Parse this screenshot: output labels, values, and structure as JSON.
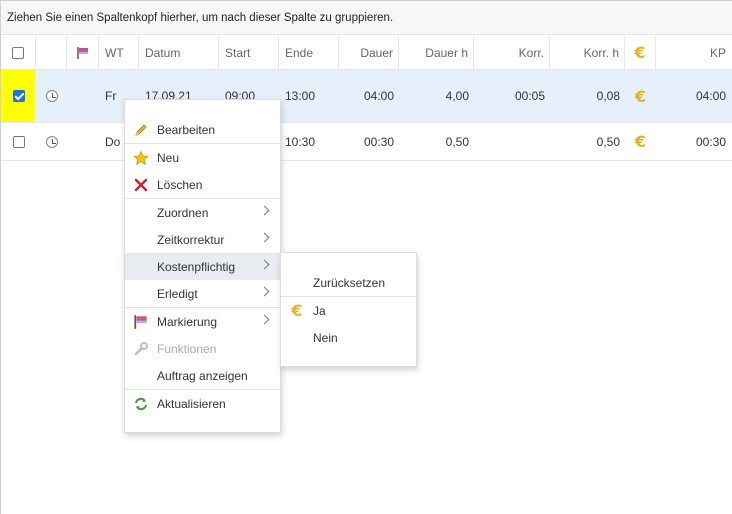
{
  "group_hint": "Ziehen Sie einen Spaltenkopf hierher, um nach dieser Spalte zu gruppieren.",
  "columns": {
    "wt": "WT",
    "datum": "Datum",
    "start": "Start",
    "ende": "Ende",
    "dauer": "Dauer",
    "dauer_h": "Dauer h",
    "korr": "Korr.",
    "korr_h": "Korr. h",
    "kp": "KP"
  },
  "rows": [
    {
      "checked": true,
      "wt": "Fr",
      "datum": "17.09.21",
      "start": "09:00",
      "ende": "13:00",
      "dauer": "04:00",
      "dauer_h": "4,00",
      "korr": "00:05",
      "korr_h": "0,08",
      "kp": "04:00"
    },
    {
      "checked": false,
      "wt": "Do",
      "datum": "",
      "start": "",
      "ende": "10:30",
      "dauer": "00:30",
      "dauer_h": "0,50",
      "korr": "",
      "korr_h": "0,50",
      "kp": "00:30"
    }
  ],
  "context_menu": {
    "edit": "Bearbeiten",
    "new": "Neu",
    "delete": "Löschen",
    "assign": "Zuordnen",
    "time_correction": "Zeitkorrektur",
    "billable": "Kostenpflichtig",
    "done": "Erledigt",
    "marking": "Markierung",
    "functions": "Funktionen",
    "show_order": "Auftrag anzeigen",
    "refresh": "Aktualisieren"
  },
  "submenu": {
    "reset": "Zurücksetzen",
    "yes": "Ja",
    "no": "Nein"
  },
  "colors": {
    "euro": "#e3b22a",
    "row_selected": "#e6f0fb",
    "highlight_yellow": "#ffff00",
    "checkbox_blue": "#1a73e8"
  },
  "icons": {
    "euro": "€"
  }
}
